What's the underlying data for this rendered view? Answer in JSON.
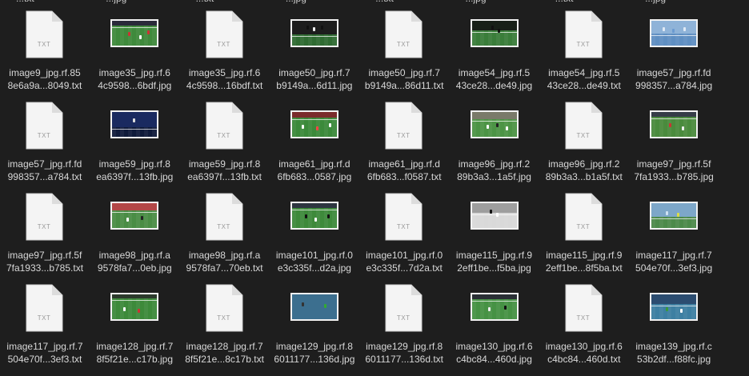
{
  "top_fragments": [
    "...txt",
    "...jpg",
    "...txt",
    "...jpg",
    "...txt",
    "...jpg",
    "...txt",
    "...jpg"
  ],
  "files": [
    {
      "kind": "txt",
      "line1": "image9_jpg.rf.85",
      "line2": "8e6a9a...8049.txt"
    },
    {
      "kind": "img",
      "style": "broadcast",
      "line1": "image35_jpg.rf.6",
      "line2": "4c9598...6bdf.jpg"
    },
    {
      "kind": "txt",
      "line1": "image35_jpg.rf.6",
      "line2": "4c9598...16bdf.txt"
    },
    {
      "kind": "img",
      "style": "closeup",
      "line1": "image50_jpg.rf.7",
      "line2": "b9149a...6d11.jpg"
    },
    {
      "kind": "txt",
      "line1": "image50_jpg.rf.7",
      "line2": "b9149a...86d11.txt"
    },
    {
      "kind": "img",
      "style": "closeup2",
      "line1": "image54_jpg.rf.5",
      "line2": "43ce28...de49.jpg"
    },
    {
      "kind": "txt",
      "line1": "image54_jpg.rf.5",
      "line2": "43ce28...de49.txt"
    },
    {
      "kind": "img",
      "style": "celebrate",
      "line1": "image57_jpg.rf.fd",
      "line2": "998357...a784.jpg"
    },
    {
      "kind": "txt",
      "line1": "image57_jpg.rf.fd",
      "line2": "998357...a784.txt"
    },
    {
      "kind": "img",
      "style": "dark",
      "line1": "image59_jpg.rf.8",
      "line2": "ea6397f...13fb.jpg"
    },
    {
      "kind": "txt",
      "line1": "image59_jpg.rf.8",
      "line2": "ea6397f...13fb.txt"
    },
    {
      "kind": "img",
      "style": "wide",
      "line1": "image61_jpg.rf.d",
      "line2": "6fb683...0587.jpg"
    },
    {
      "kind": "txt",
      "line1": "image61_jpg.rf.d",
      "line2": "6fb683...f0587.txt"
    },
    {
      "kind": "img",
      "style": "goal",
      "line1": "image96_jpg.rf.2",
      "line2": "89b3a3...1a5f.jpg"
    },
    {
      "kind": "txt",
      "line1": "image96_jpg.rf.2",
      "line2": "89b3a3...b1a5f.txt"
    },
    {
      "kind": "img",
      "style": "broadcast2",
      "line1": "image97_jpg.rf.5f",
      "line2": "7fa1933...b785.jpg"
    },
    {
      "kind": "txt",
      "line1": "image97_jpg.rf.5f",
      "line2": "7fa1933...b785.txt"
    },
    {
      "kind": "img",
      "style": "crowdwide",
      "line1": "image98_jpg.rf.a",
      "line2": "9578fa7...0eb.jpg"
    },
    {
      "kind": "txt",
      "line1": "image98_jpg.rf.a",
      "line2": "9578fa7...70eb.txt"
    },
    {
      "kind": "img",
      "style": "wide2",
      "line1": "image101_jpg.rf.0",
      "line2": "e3c335f...d2a.jpg"
    },
    {
      "kind": "txt",
      "line1": "image101_jpg.rf.0",
      "line2": "e3c335f...7d2a.txt"
    },
    {
      "kind": "img",
      "style": "stripes",
      "line1": "image115_jpg.rf.9",
      "line2": "2eff1be...f5ba.jpg"
    },
    {
      "kind": "txt",
      "line1": "image115_jpg.rf.9",
      "line2": "2eff1be...8f5ba.txt"
    },
    {
      "kind": "img",
      "style": "skyblue",
      "line1": "image117_jpg.rf.7",
      "line2": "504e70f...3ef3.jpg"
    },
    {
      "kind": "txt",
      "line1": "image117_jpg.rf.7",
      "line2": "504e70f...3ef3.txt"
    },
    {
      "kind": "img",
      "style": "wide3",
      "line1": "image128_jpg.rf.7",
      "line2": "8f5f21e...c17b.jpg"
    },
    {
      "kind": "txt",
      "line1": "image128_jpg.rf.7",
      "line2": "8f5f21e...8c17b.txt"
    },
    {
      "kind": "img",
      "style": "split",
      "line1": "image129_jpg.rf.8",
      "line2": "6011177...136d.jpg"
    },
    {
      "kind": "txt",
      "line1": "image129_jpg.rf.8",
      "line2": "6011177...136d.txt"
    },
    {
      "kind": "img",
      "style": "wide4",
      "line1": "image130_jpg.rf.6",
      "line2": "c4bc84...460d.jpg"
    },
    {
      "kind": "txt",
      "line1": "image130_jpg.rf.6",
      "line2": "c4bc84...460d.txt"
    },
    {
      "kind": "img",
      "style": "wide5",
      "line1": "image139_jpg.rf.c",
      "line2": "53b2df...f88fc.jpg"
    }
  ],
  "icon_label": "TXT",
  "colors": {
    "background": "#1e1e1e",
    "label": "#d8d8d8",
    "doc_fill": "#f4f4f4",
    "doc_fold": "#dcdcdc",
    "pitch_green": "#3d7a3a"
  }
}
